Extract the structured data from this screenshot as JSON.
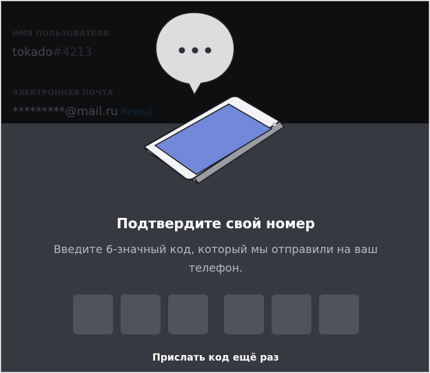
{
  "background_account": {
    "username_label": "ИМЯ ПОЛЬЗОВАТЕЛЯ",
    "username": "tokado",
    "discriminator": "#4213",
    "email_label": "ЭЛЕКТРОННАЯ ПОЧТА",
    "email_masked": "*********@mail.ru",
    "reveal_label": "Reveal"
  },
  "modal": {
    "title": "Подтвердите свой номер",
    "subtitle": "Введите 6-значный код, который мы отправили на ваш телефон.",
    "code_digits": [
      "",
      "",
      "",
      "",
      "",
      ""
    ],
    "resend_label": "Прислать код ещё раз"
  },
  "colors": {
    "modal_bg": "#36393f",
    "code_box": "#4f535b",
    "phone_screen": "#7289da",
    "bubble": "#dcddde"
  },
  "icons": {
    "speech_bubble": "speech-bubble-icon",
    "phone": "phone-illustration"
  }
}
